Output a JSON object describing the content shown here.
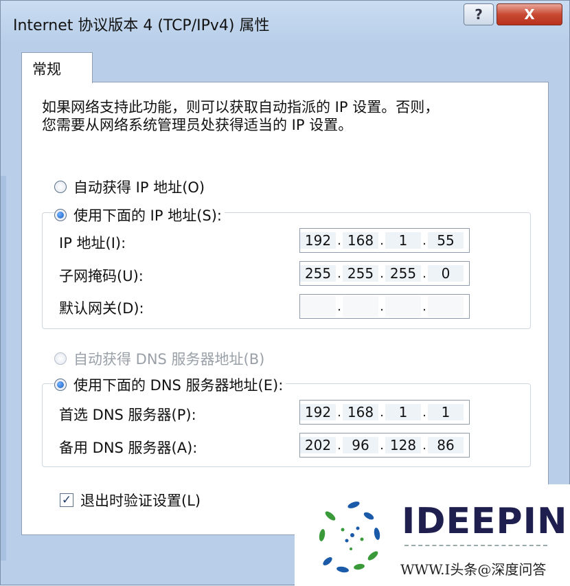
{
  "window": {
    "title": "Internet 协议版本 4 (TCP/IPv4) 属性",
    "help_label": "?",
    "close_label": "X"
  },
  "tab": {
    "label": "常规"
  },
  "description": {
    "line1": "如果网络支持此功能，则可以获取自动指派的 IP 设置。否则，",
    "line2": "您需要从网络系统管理员处获得适当的 IP 设置。"
  },
  "ip_mode": {
    "auto_label": "自动获得 IP 地址(O)",
    "manual_label": "使用下面的 IP 地址(S):",
    "selected": "manual"
  },
  "ip_fields": [
    {
      "label": "IP 地址(I):",
      "octets": [
        "192",
        "168",
        "1",
        "55"
      ]
    },
    {
      "label": "子网掩码(U):",
      "octets": [
        "255",
        "255",
        "255",
        "0"
      ]
    },
    {
      "label": "默认网关(D):",
      "octets": [
        "",
        "",
        "",
        ""
      ]
    }
  ],
  "dns_mode": {
    "auto_label": "自动获得 DNS 服务器地址(B)",
    "manual_label": "使用下面的 DNS 服务器地址(E):",
    "selected": "manual"
  },
  "dns_fields": [
    {
      "label": "首选 DNS 服务器(P):",
      "octets": [
        "192",
        "168",
        "1",
        "1"
      ]
    },
    {
      "label": "备用 DNS 服务器(A):",
      "octets": [
        "202",
        "96",
        "128",
        "86"
      ]
    }
  ],
  "validate": {
    "label": "退出时验证设置(L)",
    "checked": true,
    "mark": "✓"
  },
  "watermark": {
    "brand": "IDEEPIN",
    "site": "WWW.I头条@深度问答"
  },
  "colors": {
    "close_button": "#c84a33",
    "radio_selected": "#1b5fc0",
    "brand_text": "#1e1f4f",
    "logo_blue": "#1a5aa8",
    "logo_green": "#3a9a3a"
  }
}
